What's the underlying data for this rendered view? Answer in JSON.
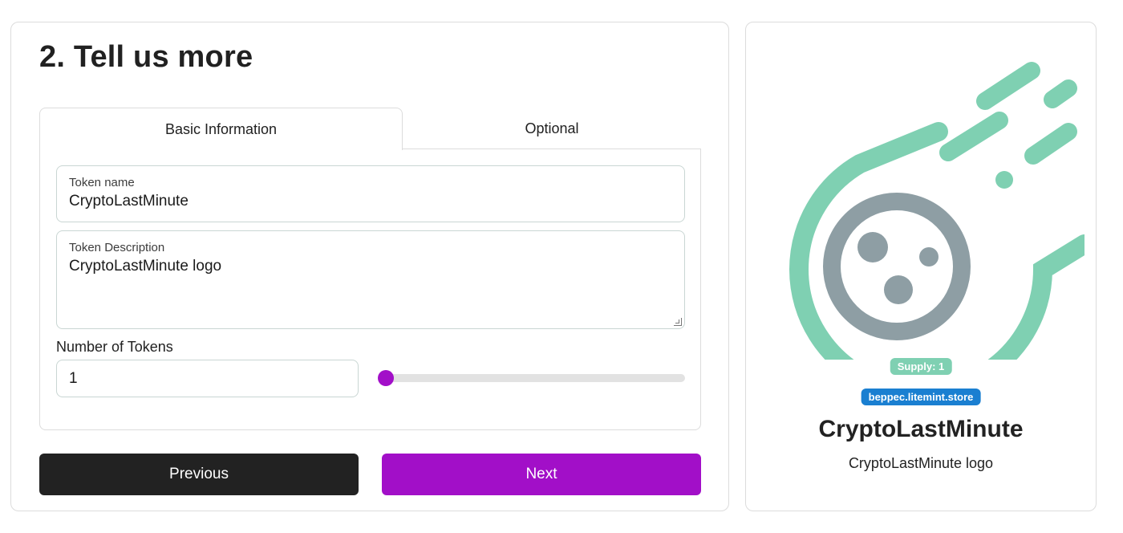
{
  "form": {
    "title": "2. Tell us more",
    "tabs": [
      {
        "label": "Basic Information",
        "active": true
      },
      {
        "label": "Optional",
        "active": false
      }
    ],
    "token_name": {
      "label": "Token name",
      "value": "CryptoLastMinute"
    },
    "token_description": {
      "label": "Token Description",
      "value": "CryptoLastMinute logo"
    },
    "number_of_tokens": {
      "label": "Number of Tokens",
      "value": "1",
      "slider_fraction": 0.0
    },
    "buttons": {
      "previous": "Previous",
      "next": "Next"
    }
  },
  "preview": {
    "logo_icon": "comet-logo-icon",
    "supply_badge": "Supply: 1",
    "domain_badge": "beppec.litemint.store",
    "name": "CryptoLastMinute",
    "description": "CryptoLastMinute logo"
  },
  "colors": {
    "accent_purple": "#a20fc8",
    "dark_button": "#222222",
    "logo_green": "#7fd0b2",
    "logo_gray": "#8e9ea4",
    "domain_blue": "#1a7fd1"
  }
}
